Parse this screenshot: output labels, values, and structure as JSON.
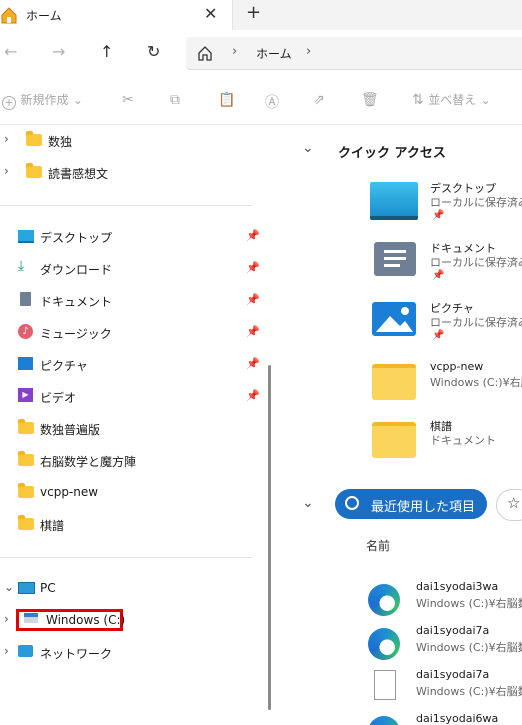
{
  "tab": {
    "title": "ホーム",
    "close": "✕",
    "new_tab": "+"
  },
  "nav": {
    "back": "←",
    "forward": "→",
    "up": "↑",
    "refresh": "↻"
  },
  "address": {
    "crumb": "ホーム",
    "sep": "›"
  },
  "toolbar": {
    "new_label": "新規作成",
    "sort_label": "並べ替え"
  },
  "sidebar": {
    "tree_top": [
      {
        "label": "数独"
      },
      {
        "label": "読書感想文"
      }
    ],
    "pinned": [
      {
        "label": "デスクトップ",
        "icon": "desktop-icon"
      },
      {
        "label": "ダウンロード",
        "icon": "download-icon"
      },
      {
        "label": "ドキュメント",
        "icon": "document-icon"
      },
      {
        "label": "ミュージック",
        "icon": "music-icon"
      },
      {
        "label": "ピクチャ",
        "icon": "picture-icon"
      },
      {
        "label": "ビデオ",
        "icon": "video-icon"
      }
    ],
    "folders": [
      {
        "label": "数独普遍版"
      },
      {
        "label": "右脳数学と魔方陣"
      },
      {
        "label": "vcpp-new"
      },
      {
        "label": "棋譜"
      }
    ],
    "drives": [
      {
        "label": "PC"
      },
      {
        "label": "Windows (C:)"
      },
      {
        "label": "ネットワーク"
      }
    ]
  },
  "quick_access": {
    "title": "クイック アクセス",
    "items": [
      {
        "name": "デスクトップ",
        "sub": "ローカルに保存済み"
      },
      {
        "name": "ドキュメント",
        "sub": "ローカルに保存済み"
      },
      {
        "name": "ピクチャ",
        "sub": "ローカルに保存済み"
      },
      {
        "name": "vcpp-new",
        "sub": "Windows (C:)¥右脳"
      },
      {
        "name": "棋譜",
        "sub": "ドキュメント"
      }
    ]
  },
  "recent": {
    "pill_label": "最近使用した項目",
    "column_name": "名前",
    "items": [
      {
        "name": "dai1syodai3wa",
        "path": "Windows (C:)¥右脳数"
      },
      {
        "name": "dai1syodai7a",
        "path": "Windows (C:)¥右脳数"
      },
      {
        "name": "dai1syodai7a",
        "path": "Windows (C:)¥右脳数"
      },
      {
        "name": "dai1syodai6wa",
        "path": ""
      }
    ]
  },
  "colors": {
    "accent": "#1a6fc4",
    "highlight_box": "#e00000",
    "folder": "#f8c93a"
  }
}
